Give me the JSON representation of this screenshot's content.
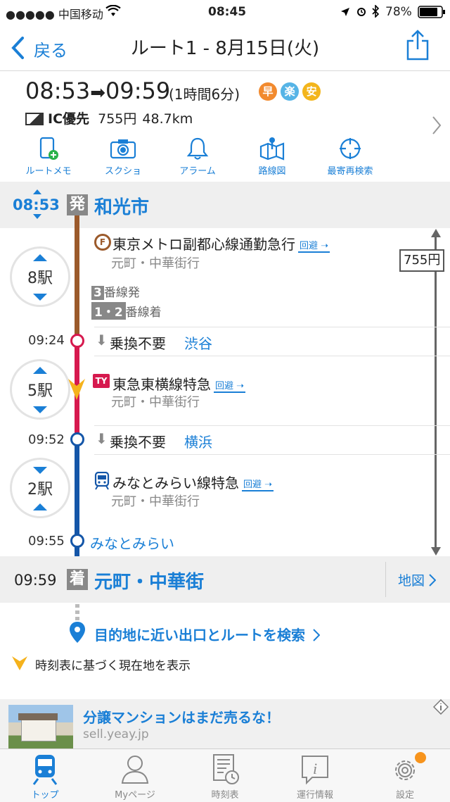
{
  "status_bar": {
    "carrier": "●●●●● 中国移动",
    "time": "08:45",
    "battery": "78%"
  },
  "nav": {
    "back_label": "戻る",
    "title": "ルート1 - 8月15日(火)"
  },
  "summary": {
    "depart": "08:53",
    "arrive": "09:59",
    "duration": "(1時間6分)",
    "badges": [
      {
        "label": "早",
        "color": "#f28a2e"
      },
      {
        "label": "楽",
        "color": "#56b4e6"
      },
      {
        "label": "安",
        "color": "#f3b51c"
      }
    ],
    "fare_mode": "IC優先",
    "fare": "755円",
    "distance": "48.7km"
  },
  "toolbar": [
    {
      "label": "ルートメモ",
      "icon": "route-memo-icon"
    },
    {
      "label": "スクショ",
      "icon": "camera-icon"
    },
    {
      "label": "アラーム",
      "icon": "bell-icon"
    },
    {
      "label": "路線図",
      "icon": "route-map-icon"
    },
    {
      "label": "最寄再検索",
      "icon": "crosshair-icon"
    }
  ],
  "route": {
    "origin": {
      "time": "08:53",
      "badge": "発",
      "name": "和光市"
    },
    "destination": {
      "time": "09:59",
      "badge": "着",
      "name": "元町・中華街",
      "map_label": "地図"
    },
    "total_fare": "755円",
    "legs": [
      {
        "stops": "8駅",
        "line": "東京メトロ副都心線通勤急行",
        "kaihi": "回避",
        "direction": "元町・中華街行",
        "line_badge": "F",
        "color": "#9b5a2b",
        "platform_dep": "番線発",
        "platform_dep_num": "3",
        "platform_arr": "番線着",
        "platform_arr_num": "1・2"
      },
      {
        "stops": "5駅",
        "line": "東急東横線特急",
        "kaihi": "回避",
        "direction": "元町・中華街行",
        "line_badge": "TY",
        "color": "#d6194e"
      },
      {
        "stops": "2駅",
        "line": "みなとみらい線特急",
        "kaihi": "回避",
        "direction": "元町・中華街行",
        "line_badge": "train",
        "color": "#1456a8"
      }
    ],
    "transfers": [
      {
        "time": "09:24",
        "text": "乗換不要",
        "station": "渋谷"
      },
      {
        "time": "09:52",
        "text": "乗換不要",
        "station": "横浜"
      }
    ],
    "last_stop": {
      "time": "09:55",
      "station": "みなとみらい"
    }
  },
  "exit_search": "目的地に近い出口とルートを検索",
  "timetable_note": "時刻表に基づく現在地を表示",
  "ad": {
    "title": "分譲マンションはまだ売るな！",
    "url": "sell.yeay.jp"
  },
  "tabs": [
    {
      "label": "トップ",
      "icon": "train-icon",
      "active": true
    },
    {
      "label": "Myページ",
      "icon": "person-icon"
    },
    {
      "label": "時刻表",
      "icon": "timetable-icon"
    },
    {
      "label": "運行情報",
      "icon": "info-icon"
    },
    {
      "label": "設定",
      "icon": "gear-icon"
    }
  ],
  "colors": {
    "accent": "#1a7fd6",
    "brown": "#9b5a2b",
    "red": "#d6194e",
    "navy": "#1456a8"
  }
}
